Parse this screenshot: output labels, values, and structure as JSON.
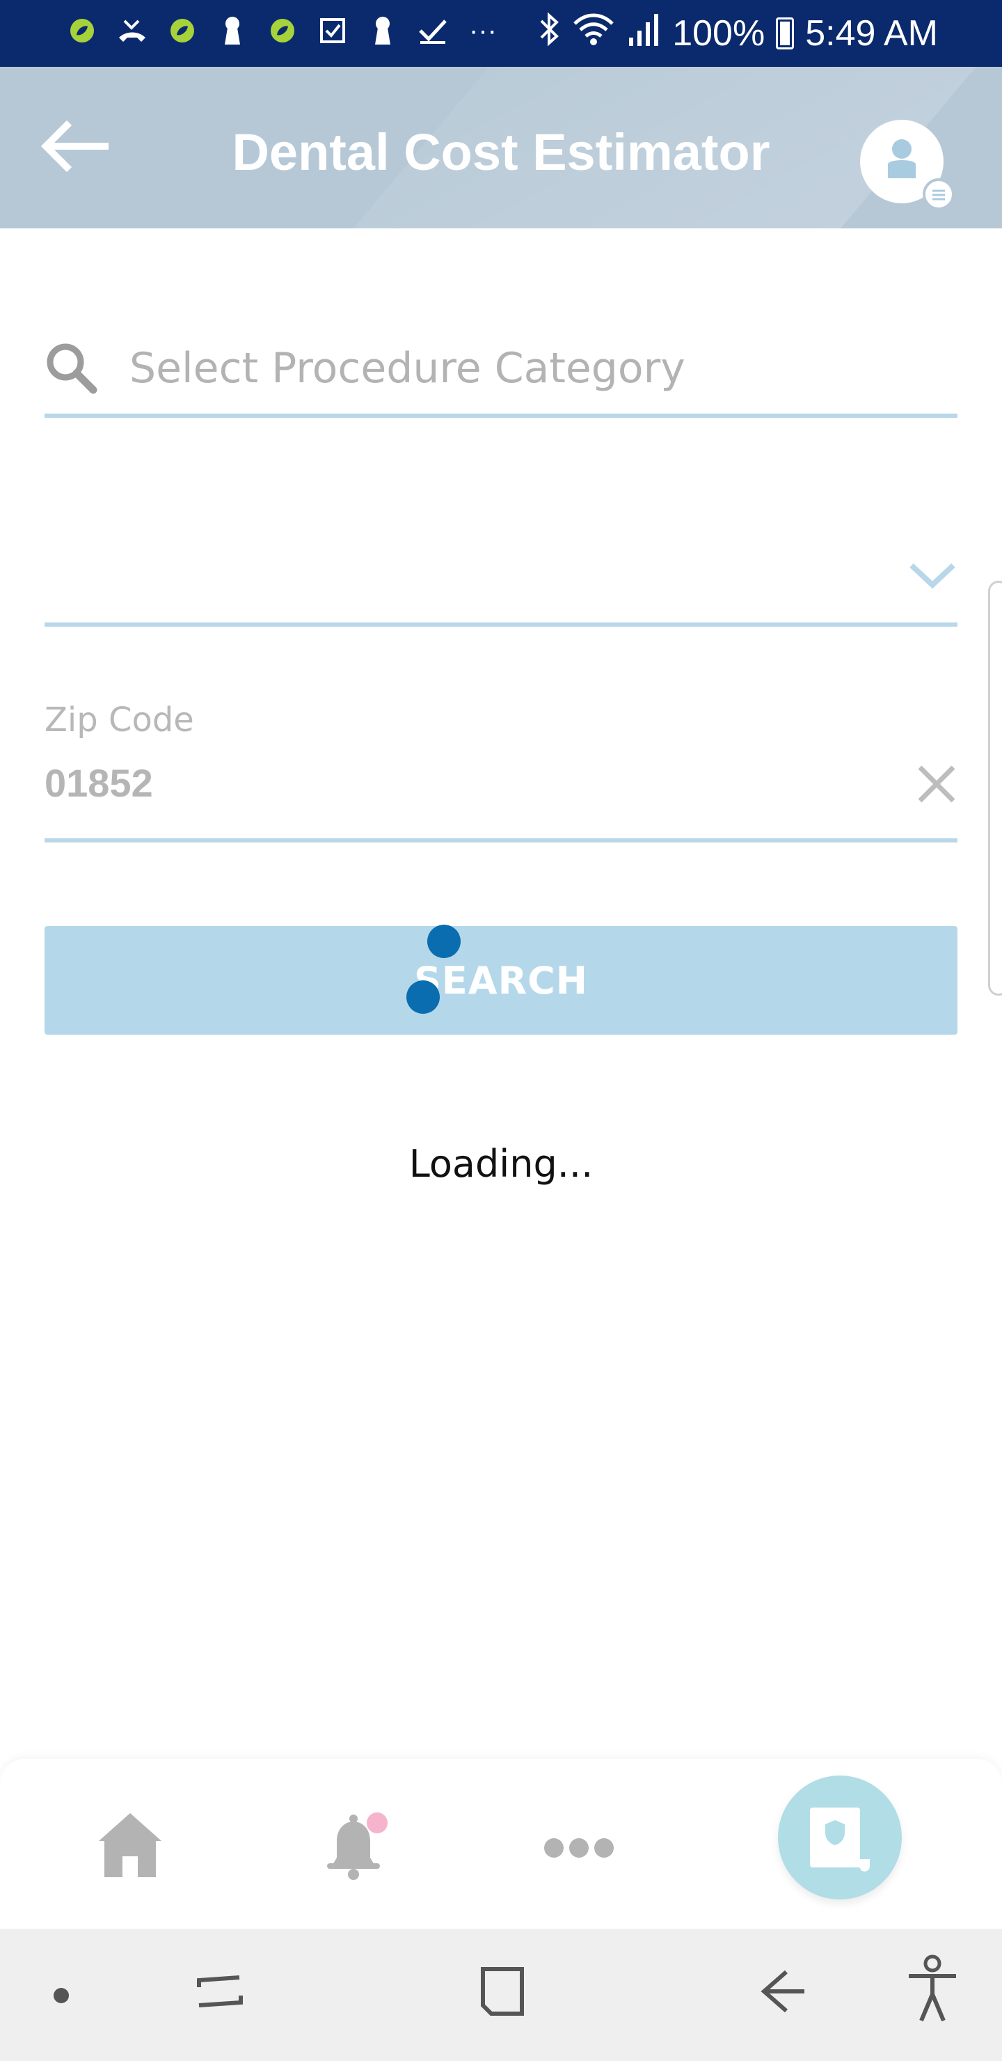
{
  "status_bar": {
    "battery_percent": "100%",
    "time": "5:49 AM",
    "overflow_indicator": "···",
    "left_icons": [
      "app-leaf-icon",
      "missed-call-icon",
      "app-leaf-icon",
      "keyhole-icon",
      "app-leaf-icon",
      "checkbox-icon",
      "keyhole-icon",
      "check-icon"
    ],
    "right_icons": [
      "bluetooth-icon",
      "wifi-icon",
      "signal-icon",
      "battery-icon"
    ]
  },
  "header": {
    "title": "Dental Cost Estimator",
    "back_icon": "arrow-left-icon",
    "avatar_icon": "user-avatar-icon"
  },
  "form": {
    "procedure_search": {
      "placeholder": "Select Procedure Category",
      "value": ""
    },
    "procedure_dropdown": {
      "selected": ""
    },
    "zip": {
      "label": "Zip Code",
      "value": "01852"
    },
    "search_button_label": "SEARCH"
  },
  "loading_text": "Loading...",
  "bottom_nav": {
    "items": [
      "home-icon",
      "bell-icon",
      "more-icon",
      "id-card-icon"
    ]
  },
  "colors": {
    "status_bar": "#0b2a6e",
    "header": "#b6c8d6",
    "accent_line": "#b8d7e8",
    "button": "#b4d8ea",
    "spinner": "#0a6db0",
    "notification_dot": "#f5b3cc"
  }
}
